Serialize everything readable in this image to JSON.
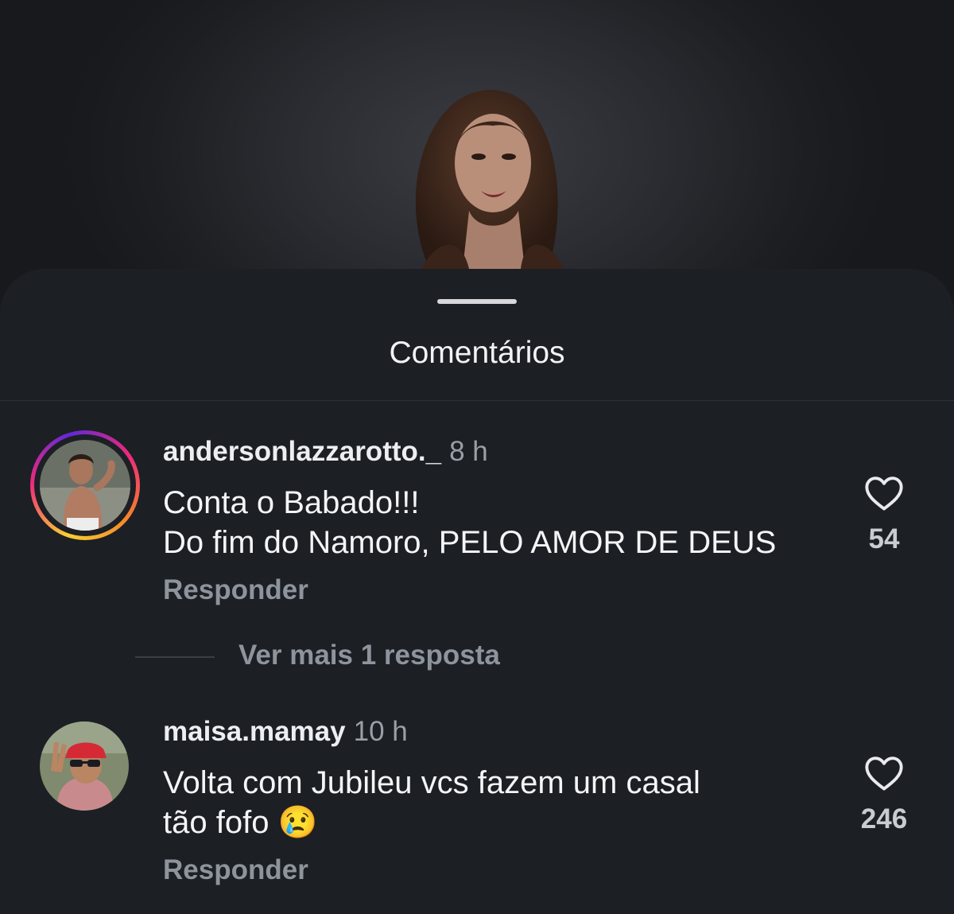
{
  "sheet": {
    "title": "Comentários"
  },
  "comments": [
    {
      "username": "andersonlazzarotto._",
      "time": "8 h",
      "line1": "Conta o Babado!!!",
      "line2": "Do fim do Namoro, PELO AMOR DE DEUS",
      "reply_label": "Responder",
      "likes": "54",
      "has_story_ring": true
    },
    {
      "username": "maisa.mamay",
      "time": "10 h",
      "line1": "Volta com Jubileu vcs fazem um casal",
      "line2": "tão fofo",
      "emoji": "😢",
      "reply_label": "Responder",
      "likes": "246",
      "has_story_ring": false
    }
  ],
  "view_more_replies": "Ver mais 1 resposta",
  "icons": {
    "like": "heart-outline-icon"
  },
  "colors": {
    "sheet": "#1c1f24",
    "ring_start": "#f9ce34",
    "ring_mid": "#ee2a7b"
  }
}
